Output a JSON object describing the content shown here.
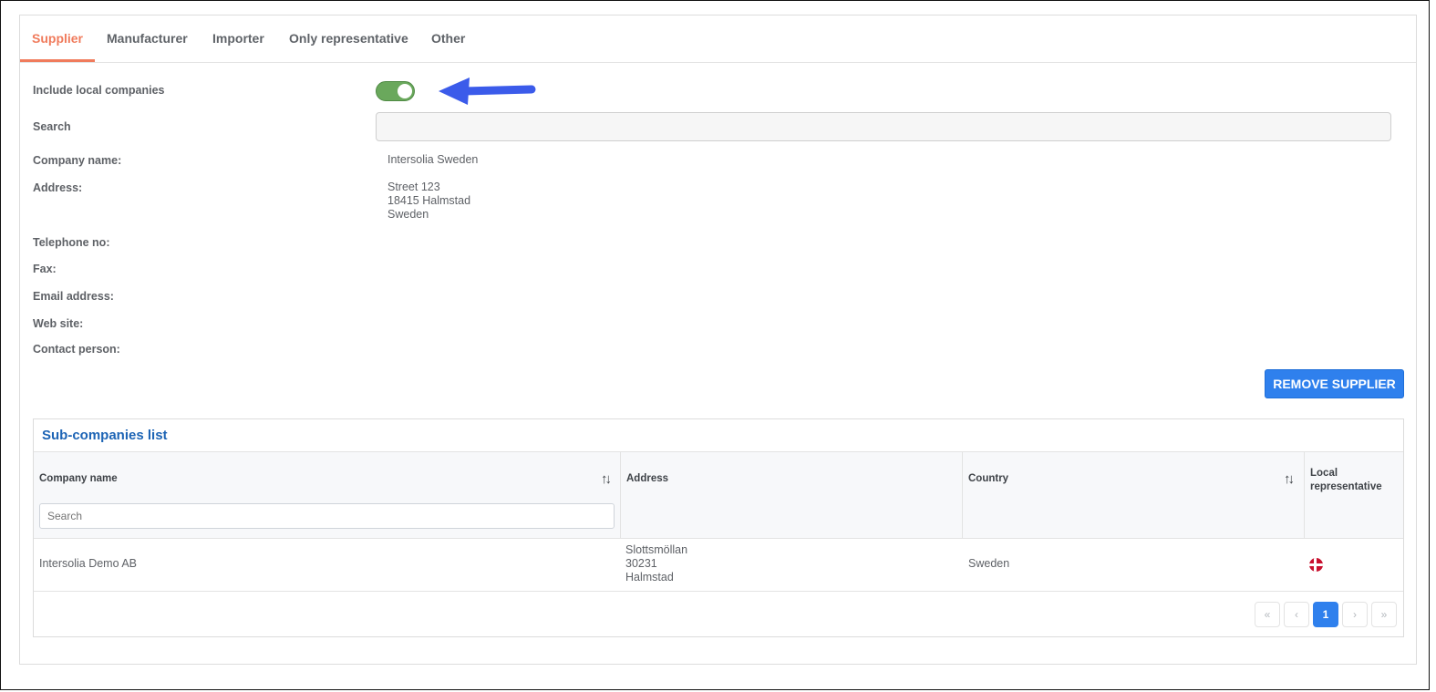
{
  "tabs": [
    {
      "label": "Supplier",
      "active": true
    },
    {
      "label": "Manufacturer",
      "active": false
    },
    {
      "label": "Importer",
      "active": false
    },
    {
      "label": "Only representative",
      "active": false
    },
    {
      "label": "Other",
      "active": false
    }
  ],
  "form": {
    "include_local_label": "Include local companies",
    "include_local_on": true,
    "search_label": "Search",
    "search_value": "",
    "company_name_label": "Company name:",
    "company_name": "Intersolia Sweden",
    "address_label": "Address:",
    "address_line1": "Street 123",
    "address_line2": "18415 Halmstad",
    "address_line3": "Sweden",
    "telephone_label": "Telephone no:",
    "fax_label": "Fax:",
    "email_label": "Email address:",
    "website_label": "Web site:",
    "contact_label": "Contact person:"
  },
  "remove_button": "REMOVE SUPPLIER",
  "subcompanies": {
    "title": "Sub-companies list",
    "columns": {
      "company_name": "Company name",
      "address": "Address",
      "country": "Country",
      "local_rep_line1": "Local",
      "local_rep_line2": "representative"
    },
    "search_placeholder": "Search",
    "rows": [
      {
        "company_name": "Intersolia Demo AB",
        "address_line1": "Slottsmöllan",
        "address_line2": "30231",
        "address_line3": "Halmstad",
        "country": "Sweden",
        "local_rep_icon": "danish-flag-icon"
      }
    ]
  },
  "pagination": {
    "first": "«",
    "prev": "‹",
    "current": "1",
    "next": "›",
    "last": "»"
  },
  "colors": {
    "accent_tab": "#f07b5c",
    "toggle_on": "#6aa85c",
    "primary_button": "#2f80ed",
    "title_blue": "#1d64b5",
    "annotation_arrow": "#3b5bea"
  }
}
